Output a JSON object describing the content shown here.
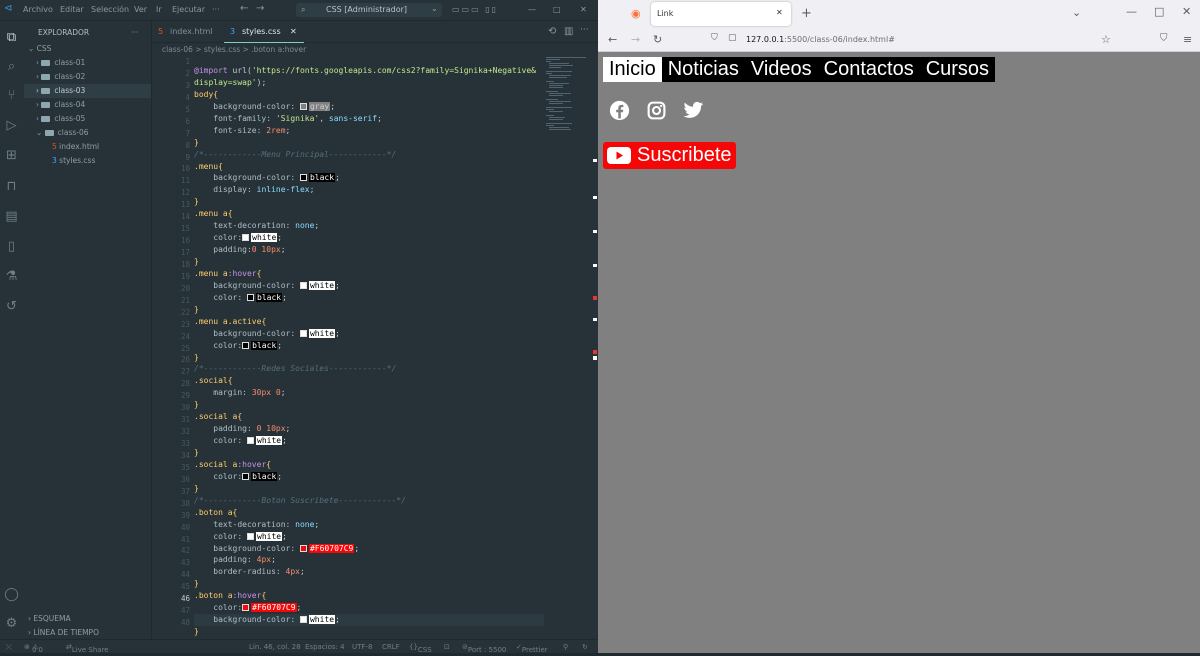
{
  "vscode": {
    "menu": [
      "Archivo",
      "Editar",
      "Selección",
      "Ver",
      "Ir",
      "Ejecutar",
      "···"
    ],
    "title": "CSS [Administrador]",
    "explorer_title": "EXPLORADOR",
    "root": "CSS",
    "folders": [
      "class-01",
      "class-02",
      "class-03",
      "class-04",
      "class-05",
      "class-06"
    ],
    "files": [
      "index.html",
      "styles.css"
    ],
    "outline": "ESQUEMA",
    "timeline": "LÍNEA DE TIEMPO",
    "tabs": [
      "index.html",
      "styles.css"
    ],
    "breadcrumb": "class-06 > styles.css > .boton a:hover",
    "status": {
      "errors": "0",
      "warnings": "0",
      "live_share": "Live Share",
      "position": "Lín. 46, col. 28",
      "spaces": "Espacios: 4",
      "encoding": "UTF-8",
      "eol": "CRLF",
      "lang": "CSS",
      "port": "Port : 5500",
      "prettier": "Prettier"
    }
  },
  "browser": {
    "tab_title": "Link",
    "url_host": "127.0.0.1",
    "url_rest": ":5500/class-06/index.html#",
    "menu": [
      "Inicio",
      "Noticias",
      "Videos",
      "Contactos",
      "Cursos"
    ],
    "social": [
      "facebook-icon",
      "instagram-icon",
      "twitter-icon"
    ],
    "button": "Suscribete",
    "colors": {
      "page": "#808080",
      "button": "#F60707",
      "menu": "#000000"
    }
  }
}
